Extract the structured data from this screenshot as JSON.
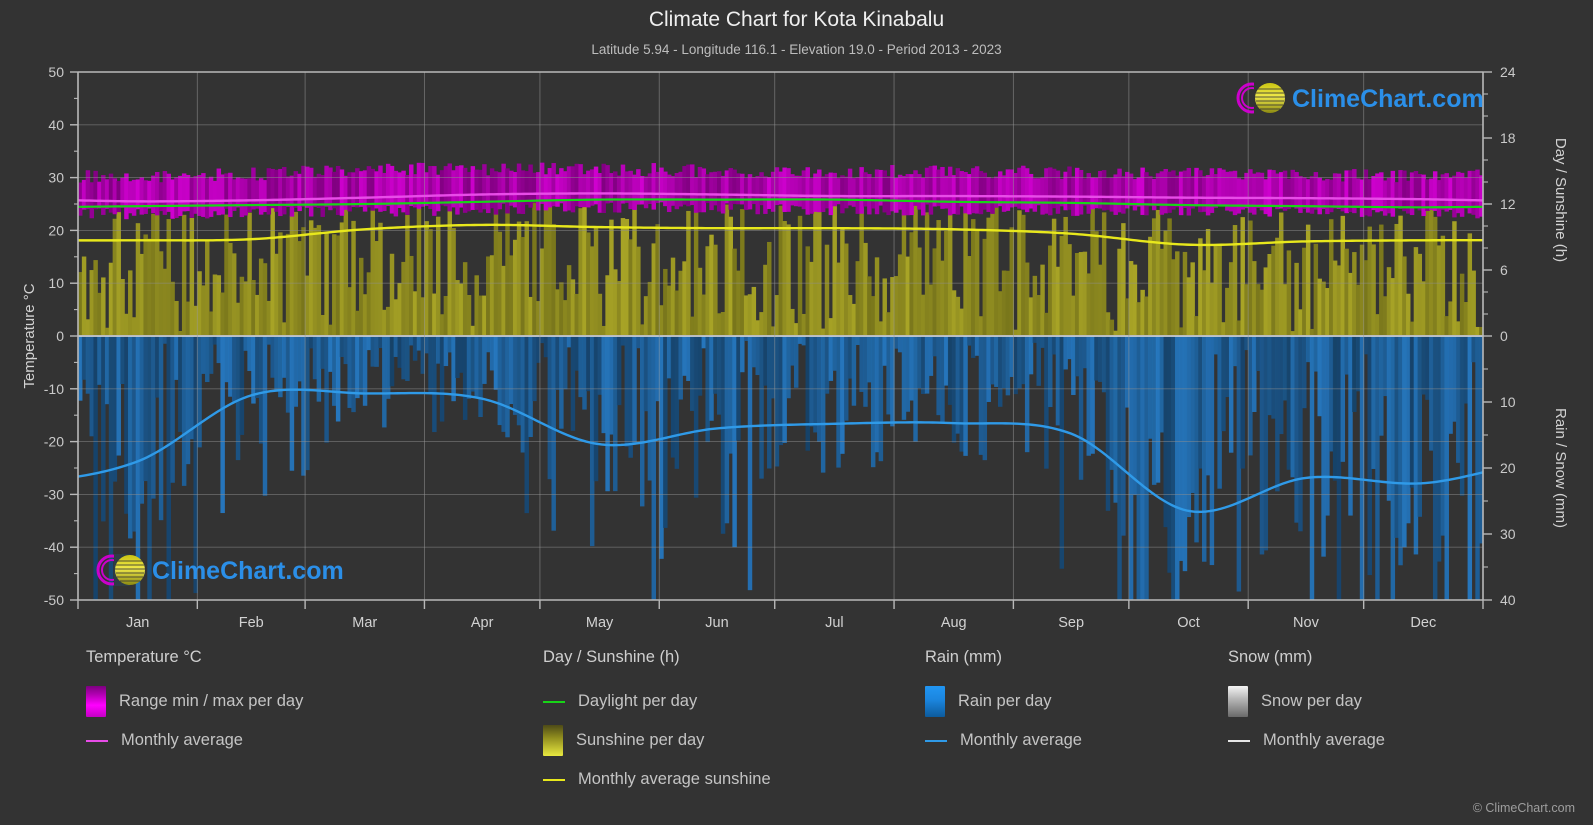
{
  "header": {
    "title": "Climate Chart for Kota Kinabalu",
    "subtitle": "Latitude 5.94 - Longitude 116.1 - Elevation 19.0 - Period 2013 - 2023"
  },
  "branding": {
    "logo_text": "ClimeChart.com",
    "copyright": "© ClimeChart.com"
  },
  "legend": {
    "columns": [
      {
        "title": "Temperature °C",
        "items": [
          {
            "label": "Range min / max per day",
            "marker": "swatch",
            "color": "#ff00ff"
          },
          {
            "label": "Monthly average",
            "marker": "line",
            "color": "#e84ce8"
          }
        ]
      },
      {
        "title": "Day / Sunshine (h)",
        "items": [
          {
            "label": "Daylight per day",
            "marker": "line",
            "color": "#17d417"
          },
          {
            "label": "Sunshine per day",
            "marker": "swatch",
            "color": "#b3b32a"
          },
          {
            "label": "Monthly average sunshine",
            "marker": "line",
            "color": "#e8e81c"
          }
        ]
      },
      {
        "title": "Rain (mm)",
        "items": [
          {
            "label": "Rain per day",
            "marker": "swatch",
            "color": "#1b85de"
          },
          {
            "label": "Monthly average",
            "marker": "line",
            "color": "#2f9ae8"
          }
        ]
      },
      {
        "title": "Snow (mm)",
        "items": [
          {
            "label": "Snow per day",
            "marker": "swatch",
            "color": "#c8c8c8"
          },
          {
            "label": "Monthly average",
            "marker": "line",
            "color": "#e6e6e6"
          }
        ]
      }
    ]
  },
  "chart_data": {
    "type": "area",
    "title": "Climate Chart for Kota Kinabalu",
    "subtitle": "Latitude 5.94 - Longitude 116.1 - Elevation 19.0 - Period 2013 - 2023",
    "xlabel": "",
    "categories": [
      "Jan",
      "Feb",
      "Mar",
      "Apr",
      "May",
      "Jun",
      "Jul",
      "Aug",
      "Sep",
      "Oct",
      "Nov",
      "Dec"
    ],
    "xtick_labels": [
      "Jan",
      "Feb",
      "Mar",
      "Apr",
      "May",
      "Jun",
      "Jul",
      "Aug",
      "Sep",
      "Oct",
      "Nov",
      "Dec"
    ],
    "grid": true,
    "legend_position": "bottom",
    "axes": {
      "left": {
        "label": "Temperature °C",
        "min": -50,
        "max": 50,
        "step": 10,
        "ticks": [
          50,
          40,
          30,
          20,
          10,
          0,
          -10,
          -20,
          -30,
          -40,
          -50
        ]
      },
      "right_top": {
        "label": "Day / Sunshine (h)",
        "min": 0,
        "max": 24,
        "step": 6,
        "ticks": [
          24,
          18,
          12,
          6,
          0
        ],
        "maps_to_temperature": [
          0,
          50
        ]
      },
      "right_bottom": {
        "label": "Rain / Snow (mm)",
        "min": 0,
        "max": 40,
        "step": 10,
        "ticks": [
          0,
          10,
          20,
          30,
          40
        ],
        "maps_to_temperature": [
          0,
          -50
        ]
      }
    },
    "series": [
      {
        "name": "Range min / max per day",
        "type": "band",
        "unit": "°C",
        "color": "#cc00cc",
        "monthly_min": [
          23.2,
          23.3,
          23.6,
          24.0,
          24.3,
          24.1,
          23.9,
          23.9,
          23.8,
          23.7,
          23.7,
          23.5
        ],
        "monthly_max": [
          30.2,
          30.7,
          31.3,
          31.7,
          31.6,
          31.3,
          31.1,
          31.1,
          31.0,
          30.6,
          30.5,
          30.3
        ]
      },
      {
        "name": "Temperature monthly average",
        "type": "line",
        "unit": "°C",
        "color": "#e84ce8",
        "values": [
          25.5,
          25.7,
          26.2,
          26.8,
          27.0,
          26.8,
          26.5,
          26.5,
          26.4,
          26.2,
          26.1,
          25.9
        ]
      },
      {
        "name": "Daylight per day",
        "type": "line",
        "unit": "h",
        "color": "#17d417",
        "values": [
          11.8,
          11.9,
          12.0,
          12.2,
          12.4,
          12.4,
          12.4,
          12.2,
          12.1,
          11.9,
          11.8,
          11.7
        ]
      },
      {
        "name": "Sunshine per day",
        "type": "bars",
        "unit": "h",
        "color": "#b3b32a",
        "daily_range_typical": [
          0,
          11.5
        ]
      },
      {
        "name": "Monthly average sunshine",
        "type": "line",
        "unit": "h",
        "color": "#e8e81c",
        "values": [
          8.7,
          8.8,
          9.7,
          10.1,
          9.9,
          9.8,
          9.8,
          9.7,
          9.3,
          8.3,
          8.6,
          8.7
        ]
      },
      {
        "name": "Rain per day",
        "type": "bars",
        "unit": "mm",
        "color": "#1b85de",
        "daily_range_typical": [
          0,
          40
        ]
      },
      {
        "name": "Rain monthly average",
        "type": "line",
        "unit": "mm",
        "color": "#2f9ae8",
        "values": [
          19.0,
          9.0,
          8.7,
          9.5,
          16.4,
          14.0,
          13.3,
          13.2,
          14.8,
          26.5,
          21.5,
          22.3
        ]
      },
      {
        "name": "Snow monthly average",
        "type": "line",
        "unit": "mm",
        "color": "#e6e6e6",
        "values": [
          0,
          0,
          0,
          0,
          0,
          0,
          0,
          0,
          0,
          0,
          0,
          0
        ]
      }
    ]
  }
}
